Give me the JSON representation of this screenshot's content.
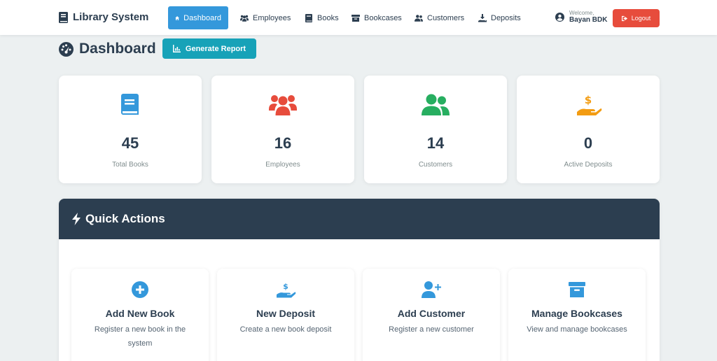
{
  "navbar": {
    "brand": "Library System",
    "items": [
      {
        "label": "Dashboard",
        "icon": "home-icon",
        "active": true
      },
      {
        "label": "Employees",
        "icon": "users-icon"
      },
      {
        "label": "Books",
        "icon": "book-icon"
      },
      {
        "label": "Bookcases",
        "icon": "archive-icon"
      },
      {
        "label": "Customers",
        "icon": "user-friends-icon"
      },
      {
        "label": "Deposits",
        "icon": "hand-holding-icon"
      }
    ],
    "welcome": "Welcome,",
    "username": "Bayan BDK",
    "logout": "Logout"
  },
  "header": {
    "title": "Dashboard",
    "report_button": "Generate Report"
  },
  "stats": [
    {
      "value": "45",
      "label": "Total Books",
      "icon": "book-icon",
      "color": "#3498db"
    },
    {
      "value": "16",
      "label": "Employees",
      "icon": "users-icon",
      "color": "#e74c3c"
    },
    {
      "value": "14",
      "label": "Customers",
      "icon": "user-friends-icon",
      "color": "#27ae60"
    },
    {
      "value": "0",
      "label": "Active Deposits",
      "icon": "hand-holding-usd-icon",
      "color": "#f39c12"
    }
  ],
  "quick_actions": {
    "title": "Quick Actions",
    "items": [
      {
        "title": "Add New Book",
        "description": "Register a new book in the system",
        "icon": "plus-circle-icon"
      },
      {
        "title": "New Deposit",
        "description": "Create a new book deposit",
        "icon": "hand-holding-usd-icon"
      },
      {
        "title": "Add Customer",
        "description": "Register a new customer",
        "icon": "user-plus-icon"
      },
      {
        "title": "Manage Bookcases",
        "description": "View and manage bookcases",
        "icon": "archive-icon"
      }
    ]
  },
  "colors": {
    "primary": "#3498db",
    "dark": "#2c3e50",
    "danger": "#e74c3c",
    "info": "#17a2b8",
    "success": "#27ae60",
    "warning": "#f39c12"
  }
}
